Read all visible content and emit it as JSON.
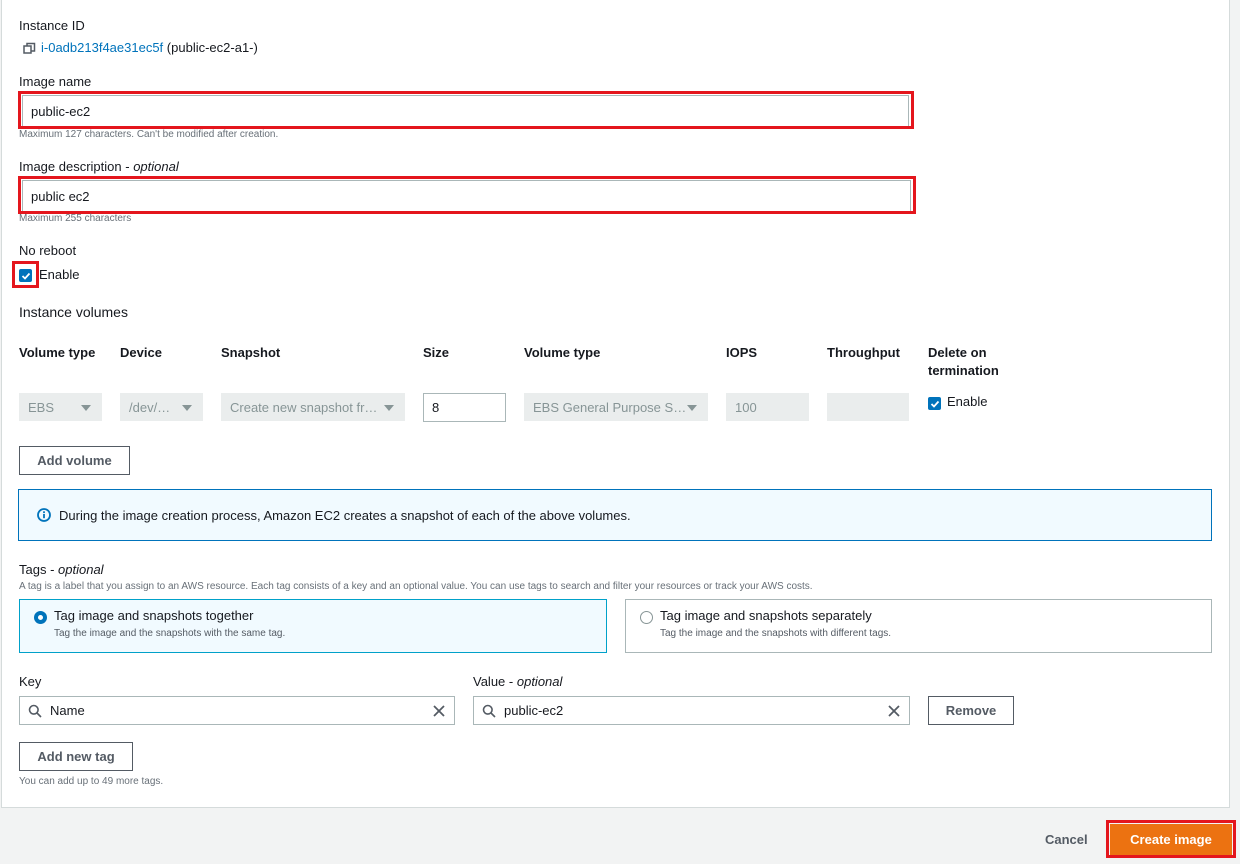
{
  "instance": {
    "label": "Instance ID",
    "id_link": "i-0adb213f4ae31ec5f",
    "name": "(public-ec2-a1-)"
  },
  "image_name": {
    "label": "Image name",
    "value": "public-ec2",
    "hint": "Maximum 127 characters. Can't be modified after creation."
  },
  "image_description": {
    "label": "Image description",
    "optional": "optional",
    "value": "public ec2",
    "hint": "Maximum 255 characters"
  },
  "no_reboot": {
    "label": "No reboot",
    "checkbox_label": "Enable",
    "checked": true
  },
  "volumes": {
    "section_title": "Instance volumes",
    "headers": [
      "Volume type",
      "Device",
      "Snapshot",
      "Size",
      "Volume type",
      "IOPS",
      "Throughput",
      "Delete on termination"
    ],
    "row": {
      "volume_type": "EBS",
      "device": "/dev/…",
      "snapshot": "Create new snapshot fr…",
      "size": "8",
      "ebs_type": "EBS General Purpose S…",
      "iops": "100",
      "throughput": "",
      "delete_label": "Enable"
    },
    "add_button": "Add volume"
  },
  "info": {
    "text": "During the image creation process, Amazon EC2 creates a snapshot of each of the above volumes."
  },
  "tags": {
    "label": "Tags",
    "optional": "optional",
    "description": "A tag is a label that you assign to an AWS resource. Each tag consists of a key and an optional value. You can use tags to search and filter your resources or track your AWS costs.",
    "option_together_title": "Tag image and snapshots together",
    "option_together_desc": "Tag the image and the snapshots with the same tag.",
    "option_separate_title": "Tag image and snapshots separately",
    "option_separate_desc": "Tag the image and the snapshots with different tags.",
    "key_label": "Key",
    "value_label": "Value",
    "value_optional": "optional",
    "key_value": "Name",
    "value_value": "public-ec2",
    "remove_button": "Remove",
    "add_tag_button": "Add new tag",
    "limit_hint": "You can add up to 49 more tags."
  },
  "footer": {
    "cancel": "Cancel",
    "create": "Create image"
  },
  "colors": {
    "primary": "#ec7211",
    "link": "#0073bb",
    "highlight": "#e4161d"
  }
}
